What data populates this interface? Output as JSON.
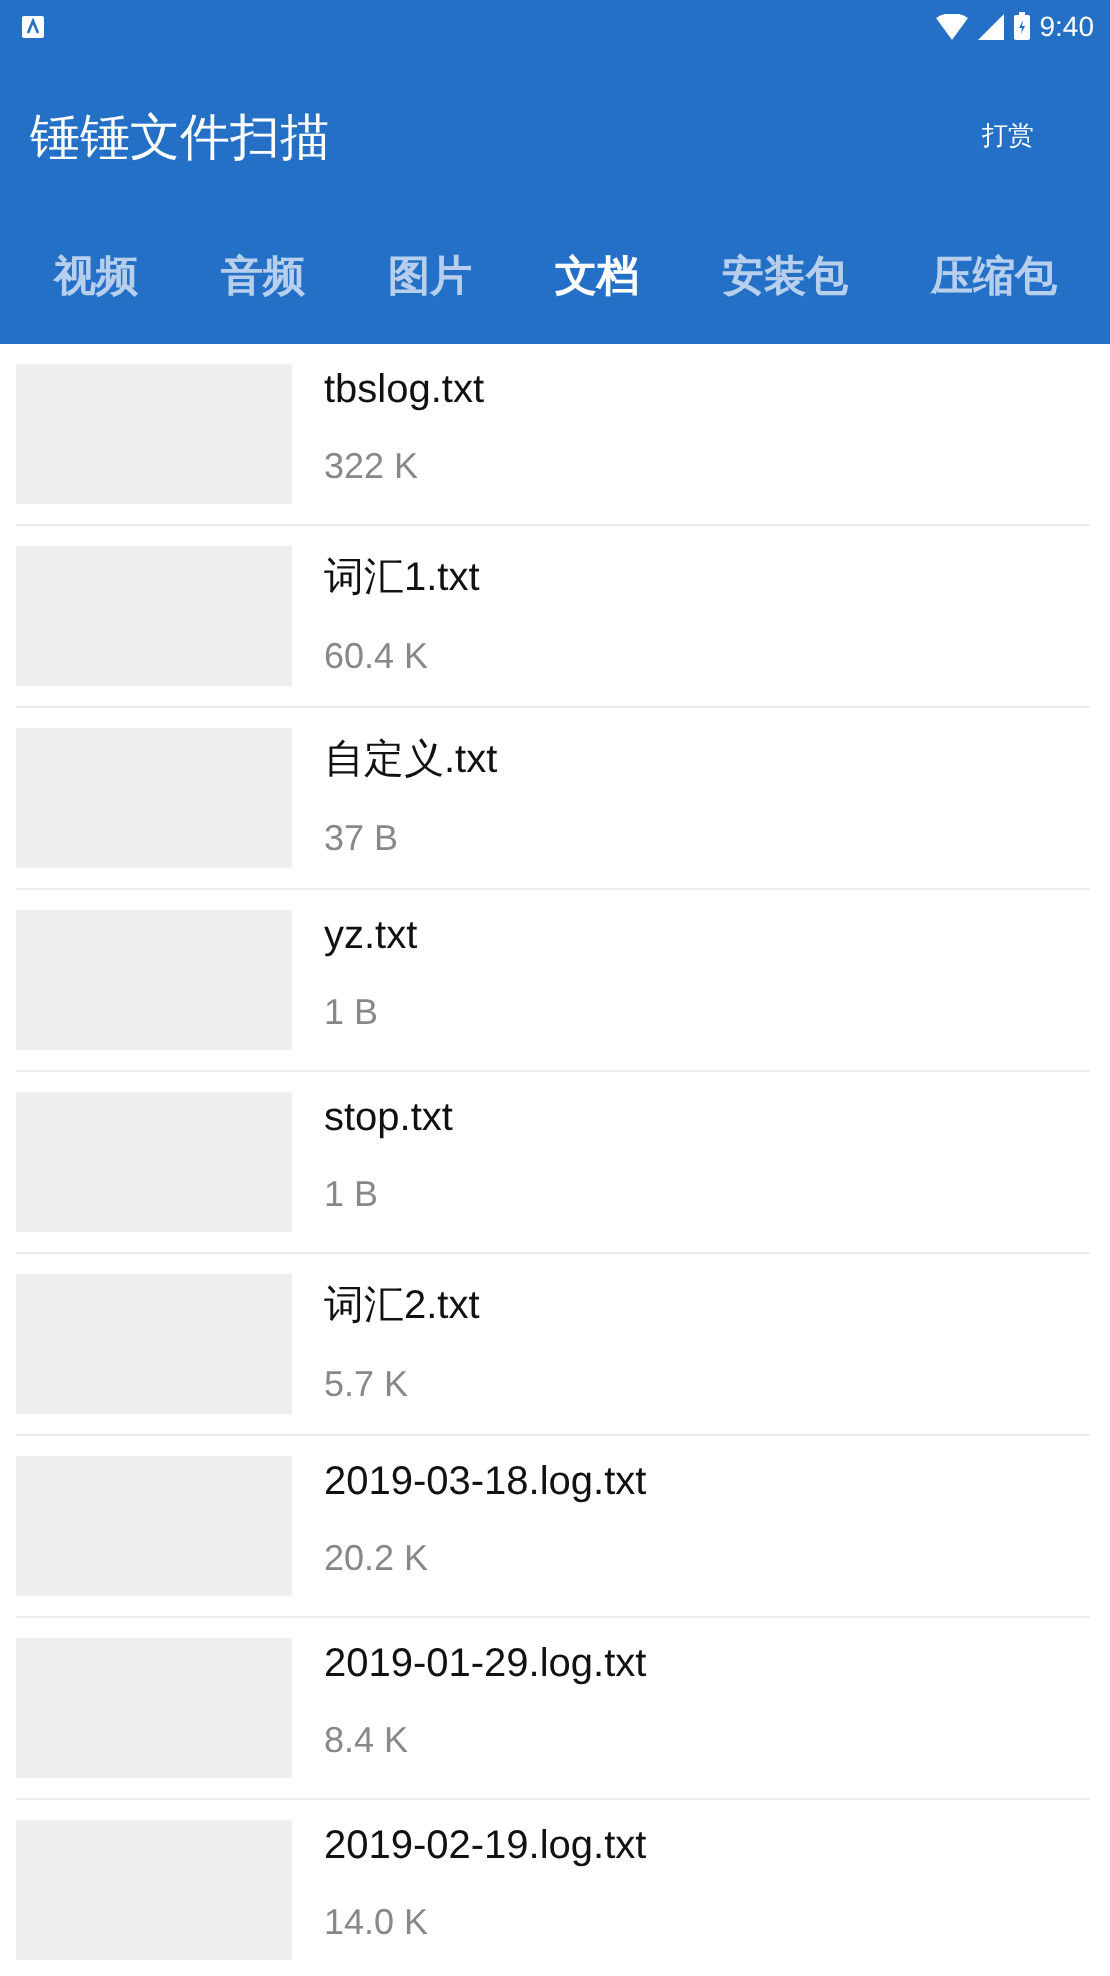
{
  "status_bar": {
    "time": "9:40"
  },
  "app_bar": {
    "title": "锤锤文件扫描",
    "action": "打赏"
  },
  "tabs": [
    {
      "label": "视频",
      "selected": false
    },
    {
      "label": "音频",
      "selected": false
    },
    {
      "label": "图片",
      "selected": false
    },
    {
      "label": "文档",
      "selected": true
    },
    {
      "label": "安装包",
      "selected": false
    },
    {
      "label": "压缩包",
      "selected": false
    }
  ],
  "files": [
    {
      "name": "tbslog.txt",
      "size": "322 K"
    },
    {
      "name": "词汇1.txt",
      "size": "60.4 K"
    },
    {
      "name": "自定义.txt",
      "size": "37 B"
    },
    {
      "name": "yz.txt",
      "size": "1 B"
    },
    {
      "name": "stop.txt",
      "size": "1 B"
    },
    {
      "name": "词汇2.txt",
      "size": "5.7 K"
    },
    {
      "name": "2019-03-18.log.txt",
      "size": "20.2 K"
    },
    {
      "name": "2019-01-29.log.txt",
      "size": "8.4 K"
    },
    {
      "name": "2019-02-19.log.txt",
      "size": "14.0 K"
    }
  ]
}
